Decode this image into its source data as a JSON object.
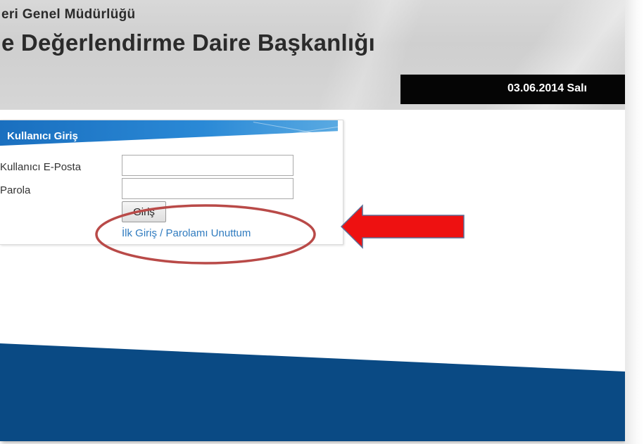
{
  "header": {
    "subtitle": "eri Genel Müdürlüğü",
    "title": "e Değerlendirme Daire Başkanlığı",
    "date": "03.06.2014 Salı"
  },
  "login": {
    "title": "Kullanıcı Giriş",
    "email_label": "Kullanıcı E-Posta",
    "email_value": "",
    "password_label": "Parola",
    "password_value": "",
    "submit_label": "Giriş",
    "forgot_link": "İlk Giriş / Parolamı Unuttum"
  },
  "colors": {
    "login_header": "#2a89d6",
    "date_bar": "#050505",
    "footer_band": "#0a4a84",
    "link": "#2f7bbf",
    "annotation_ellipse": "#b94a48",
    "annotation_arrow": "#ee1111"
  },
  "annotations": {
    "highlight_shape": "ellipse",
    "pointer_icon": "arrow-left-icon"
  }
}
